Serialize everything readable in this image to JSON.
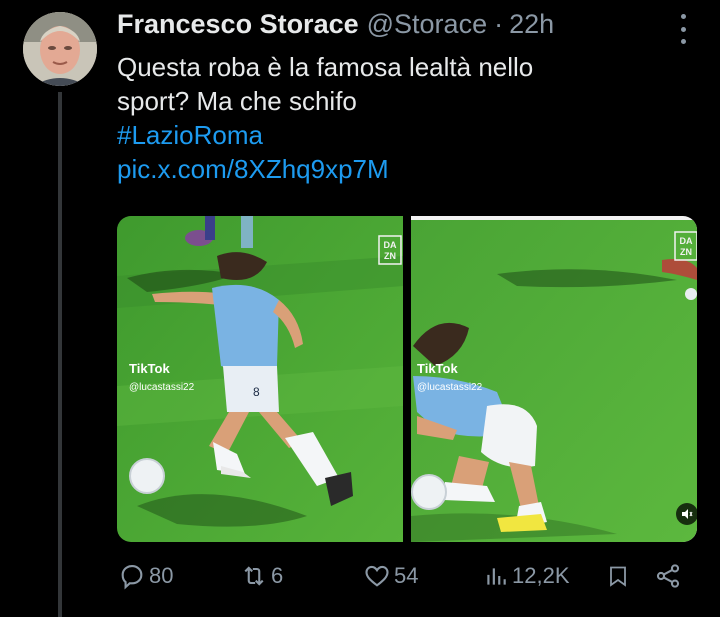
{
  "tweet": {
    "author_name": "Francesco Storace",
    "handle": "@Storace",
    "separator": "·",
    "time": "22h",
    "text_lines": [
      "Questa roba è la famosa lealtà nello",
      "sport? Ma che schifo"
    ],
    "hashtag": "#LazioRoma",
    "link": "pic.x.com/8XZhq9xp7M"
  },
  "media": {
    "left_panel": {
      "watermark_app": "TikTok",
      "watermark_user": "@lucastassi22",
      "broadcaster": "DA\nZN",
      "jersey_number": "8"
    },
    "right_panel": {
      "watermark_app": "TikTok",
      "watermark_user": "@lucastassi22",
      "broadcaster": "DA\nZN"
    }
  },
  "actions": {
    "replies": "80",
    "reposts": "6",
    "likes": "54",
    "views": "12,2K"
  },
  "icons": [
    "more-icon",
    "reply-icon",
    "repost-icon",
    "like-icon",
    "views-icon",
    "bookmark-icon",
    "share-icon",
    "speaker-icon"
  ],
  "colors": {
    "background": "#000000",
    "text": "#e7e9ea",
    "secondary": "#8b98a5",
    "link": "#1d9bf0",
    "pitch": "#4fa632"
  }
}
